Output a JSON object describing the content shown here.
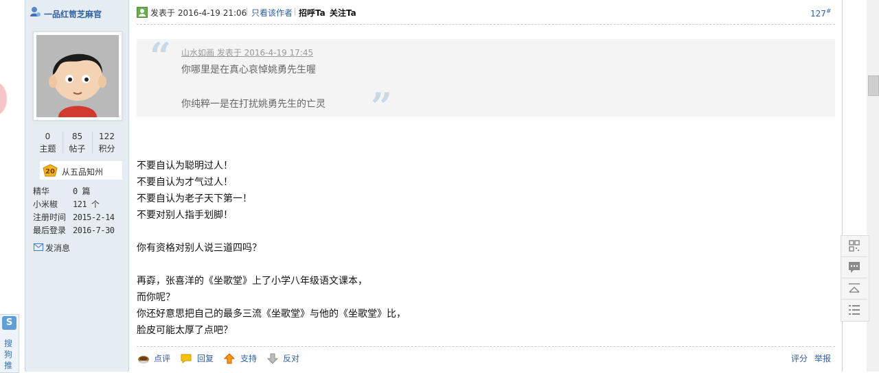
{
  "author": {
    "name": "一品红笥芝麻官",
    "stats": [
      {
        "value": "0",
        "label": "主题"
      },
      {
        "value": "85",
        "label": "帖子"
      },
      {
        "value": "122",
        "label": "积分"
      }
    ],
    "rank_level": "20",
    "rank_title": "从五品知州",
    "info": [
      {
        "label": "精华",
        "value": "0 篇"
      },
      {
        "label": "小米椒",
        "value": "121 个"
      },
      {
        "label": "注册时间",
        "value": "2015-2-14"
      },
      {
        "label": "最后登录",
        "value": "2016-7-30"
      }
    ],
    "send_message": "发消息"
  },
  "post": {
    "posted_at": "发表于 2016-4-19 21:06",
    "only_author": "只看该作者",
    "greet": "招呼Ta",
    "follow": "关注Ta",
    "floor": "127",
    "floor_mark": "#",
    "quote": {
      "header": "山水如画 发表于 2016-4-19 17:45",
      "lines": [
        "你哪里是在真心哀悼姚勇先生喔",
        "你纯粹一是在打扰姚勇先生的亡灵"
      ]
    },
    "body": [
      "不要自认为聪明过人！",
      "不要自认为才气过人！",
      "不要自认为老子天下第一！",
      "不要对别人指手划脚！",
      "",
      "你有资格对别人说三道四吗？",
      "",
      "再孬，张喜洋的《坐歌堂》上了小学八年级语文课本，",
      "而你呢？",
      "你还好意思把自己的最多三流《坐歌堂》与他的《坐歌堂》比，",
      "脸皮可能太厚了点吧？"
    ],
    "actions": {
      "comment": "点评",
      "reply": "回复",
      "support": "支持",
      "oppose": "反对",
      "rate": "评分",
      "report": "举报"
    }
  },
  "sidebar_tool": {
    "logo": "S",
    "label": "搜狗推"
  },
  "side_tools": [
    "qrcode-icon",
    "comment-icon",
    "back-to-top-icon",
    "list-icon"
  ]
}
